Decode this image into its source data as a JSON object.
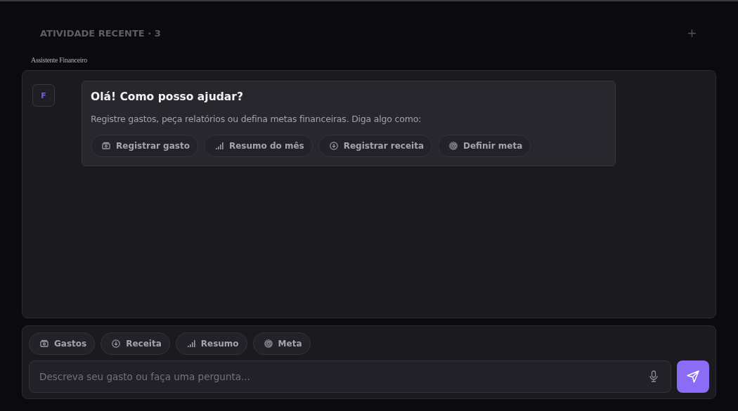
{
  "header": {
    "title": "ATIVIDADE RECENTE · 3"
  },
  "chat": {
    "label": "Assistente Financeiro",
    "avatar": "F",
    "message": {
      "title": "Olá! Como posso ajudar?",
      "text": "Registre gastos, peça relatórios ou defina metas financeiras. Diga algo como:",
      "suggestions": [
        {
          "label": "Registrar gasto",
          "kind": "cash"
        },
        {
          "label": "Resumo do mês",
          "kind": "chart"
        },
        {
          "label": "Registrar receita",
          "kind": "down"
        },
        {
          "label": "Definir meta",
          "kind": "target"
        }
      ]
    }
  },
  "composer": {
    "shortcuts": [
      {
        "label": "Gastos",
        "kind": "cash"
      },
      {
        "label": "Receita",
        "kind": "down"
      },
      {
        "label": "Resumo",
        "kind": "chart"
      },
      {
        "label": "Meta",
        "kind": "target"
      }
    ],
    "placeholder": "Descreva seu gasto ou faça uma pergunta..."
  }
}
